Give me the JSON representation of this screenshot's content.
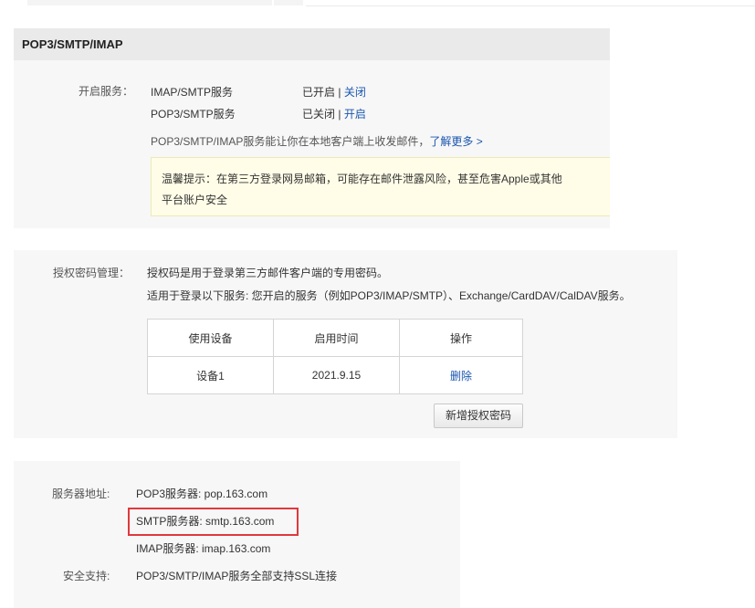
{
  "pop3_section": {
    "title": "POP3/SMTP/IMAP",
    "service_label": "开启服务：",
    "services": [
      {
        "name": "IMAP/SMTP服务",
        "status": "已开启",
        "separator": "|",
        "action": "关闭"
      },
      {
        "name": "POP3/SMTP服务",
        "status": "已关闭",
        "separator": "|",
        "action": "开启"
      }
    ],
    "description": "POP3/SMTP/IMAP服务能让你在本地客户端上收发邮件，",
    "learn_more": "了解更多 >",
    "notice_line1": "温馨提示：在第三方登录网易邮箱，可能存在邮件泄露风险，甚至危害Apple或其他",
    "notice_line2": "平台账户安全"
  },
  "auth_section": {
    "label": "授权密码管理：",
    "desc1": "授权码是用于登录第三方邮件客户端的专用密码。",
    "desc2": "适用于登录以下服务: 您开启的服务（例如POP3/IMAP/SMTP）、Exchange/CardDAV/CalDAV服务。",
    "table": {
      "headers": [
        "使用设备",
        "启用时间",
        "操作"
      ],
      "rows": [
        {
          "device": "设备1",
          "date": "2021.9.15",
          "action": "删除"
        }
      ]
    },
    "add_button": "新增授权密码"
  },
  "server_section": {
    "address_label": "服务器地址:",
    "pop3": "POP3服务器: pop.163.com",
    "smtp": "SMTP服务器: smtp.163.com",
    "imap": "IMAP服务器: imap.163.com",
    "security_label": "安全支持:",
    "security_text": "POP3/SMTP/IMAP服务全部支持SSL连接"
  },
  "colors": {
    "link": "#1a56b0",
    "highlight_border": "#e0393c",
    "notice_bg": "#fffde7"
  }
}
